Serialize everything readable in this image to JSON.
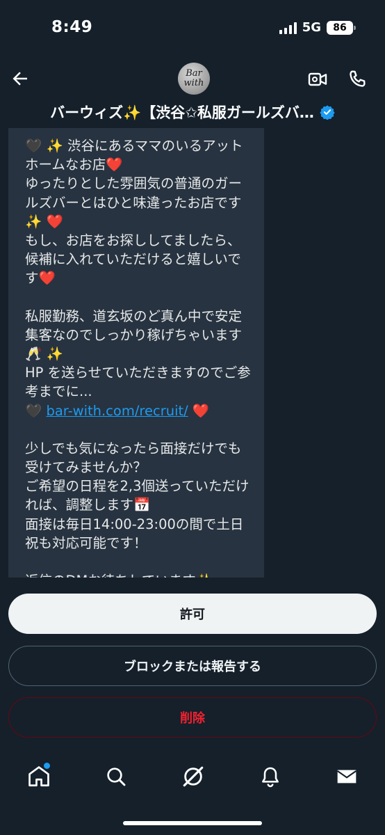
{
  "status_bar": {
    "time": "8:49",
    "network": "5G",
    "battery": "86"
  },
  "header": {
    "avatar_text_line1": "Bar",
    "avatar_text_line2": "with",
    "title": "バーウィズ✨【渋谷✩私服ガールズバ…"
  },
  "message": {
    "paragraph1": "🖤 ✨ 渋谷にあるママのいるアットホームなお店❤️\nゆったりとした雰囲気の普通のガールズバーとはひと味違ったお店です✨ ❤️\nもし、お店をお探ししてましたら、候補に入れていただけると嬉しいです❤️",
    "paragraph2": "私服勤務、道玄坂のど真ん中で安定集客なのでしっかり稼げちゃいます🥂 ✨\nHP を送らせていただきますのでご参考までに...",
    "link_prefix": "🖤 ",
    "link": "bar-with.com/recruit/",
    "link_suffix": " ❤️",
    "paragraph3": "少しでも気になったら面接だけでも受けてみませんか？\nご希望の日程を2,3個送っていただければ、調整します📅\n面接は毎日14:00-23:00の間で土日祝も対応可能です！",
    "paragraph4_cutoff": "返信のDMお待ちしています✨"
  },
  "actions": {
    "allow": "許可",
    "block_report": "ブロックまたは報告する",
    "delete": "削除"
  },
  "colors": {
    "background": "#15202b",
    "bubble": "#273340",
    "accent": "#1d9bf0",
    "delete": "#f4212e"
  },
  "nav": {
    "icons": [
      "home-icon",
      "search-icon",
      "grok-icon",
      "notifications-icon",
      "messages-icon"
    ]
  }
}
